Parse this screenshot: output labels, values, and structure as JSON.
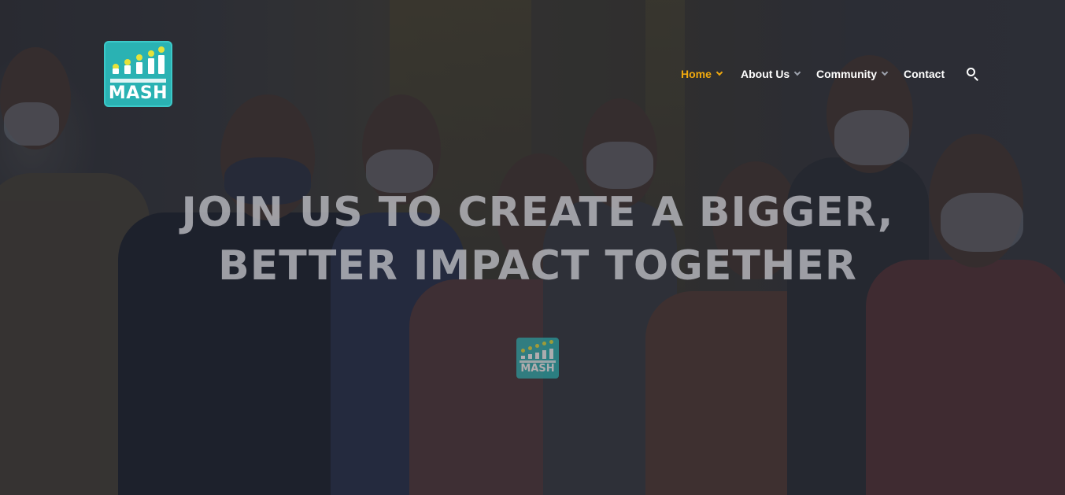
{
  "logo": {
    "text": "MASH",
    "accent_color": "#2ab2b3",
    "dot_color": "#e6e23a"
  },
  "nav": {
    "items": [
      {
        "label": "Home",
        "active": true,
        "has_dropdown": true
      },
      {
        "label": "About Us",
        "active": false,
        "has_dropdown": true
      },
      {
        "label": "Community",
        "active": false,
        "has_dropdown": true
      },
      {
        "label": "Contact",
        "active": false,
        "has_dropdown": false
      }
    ],
    "search_icon": "search-icon",
    "active_color": "#f0a90e"
  },
  "hero": {
    "headline_line1": "JOIN US TO CREATE A BIGGER,",
    "headline_line2": "BETTER IMPACT TOGETHER",
    "badge_text": "MASH"
  }
}
